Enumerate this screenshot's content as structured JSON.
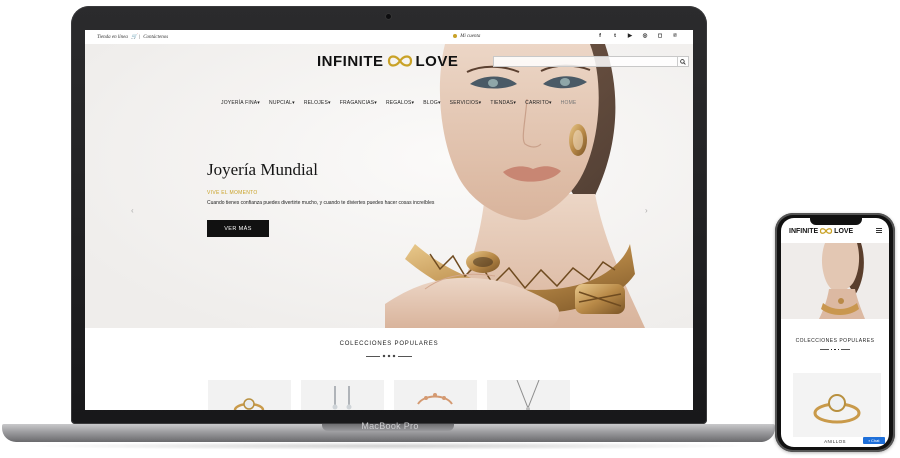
{
  "device": {
    "laptop_label": "MacBook Pro"
  },
  "topbar": {
    "left_text": "Tienda en línea",
    "left_link": "Contáctenos",
    "account": "Mi cuenta",
    "socials": [
      "facebook-icon",
      "twitter-icon",
      "youtube-icon",
      "whatsapp-icon",
      "instagram-icon",
      "pinterest-icon"
    ]
  },
  "brand": {
    "left": "INFINITE",
    "right": "LOVE",
    "accent": "#c9a227"
  },
  "search": {
    "placeholder": ""
  },
  "nav": {
    "items": [
      "JOYERÍA FINA",
      "NUPCIAL",
      "RELOJES",
      "FRAGANCIAS",
      "REGALOS",
      "BLOG",
      "SERVICIOS",
      "TIENDAS",
      "CARRITO",
      "HOME"
    ]
  },
  "hero": {
    "title": "Joyería Mundial",
    "tagline": "VIVE EL MOMENTO",
    "description": "Cuando tienes confianza puedes divertirte mucho, y cuando te diviertes puedes hacer cosas increíbles",
    "button": "VER MÁS",
    "prev_arrow": "‹",
    "next_arrow": "›"
  },
  "collections": {
    "title": "COLECCIONES POPULARES"
  },
  "mobile": {
    "brand_left": "INFINITE",
    "brand_right": "LOVE",
    "collections_title": "COLECCIONES POPULARES",
    "product_label": "ANILLOS",
    "chat_label": "Chat"
  }
}
